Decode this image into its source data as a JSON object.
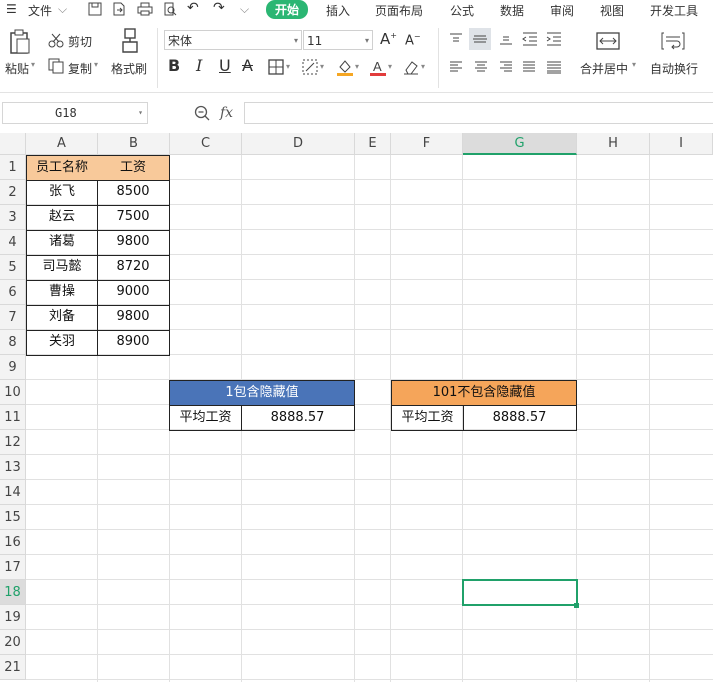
{
  "menu": {
    "hamburger_icon": "menu-icon",
    "file": "文件",
    "tabs": [
      "开始",
      "插入",
      "页面布局",
      "公式",
      "数据",
      "审阅",
      "视图",
      "开发工具"
    ],
    "active_tab": "开始"
  },
  "ribbon": {
    "paste": "粘贴",
    "cut": "剪切",
    "copy": "复制",
    "format_painter": "格式刷",
    "font_name": "宋体",
    "font_size": "11",
    "merge_center": "合并居中",
    "wrap_text": "自动换行",
    "bold": "B",
    "italic": "I",
    "underline": "U",
    "strike": "A"
  },
  "formula_bar": {
    "cell_ref": "G18",
    "fx": "fx",
    "formula": ""
  },
  "columns": [
    "A",
    "B",
    "C",
    "D",
    "E",
    "F",
    "G",
    "H",
    "I"
  ],
  "rows": [
    "1",
    "2",
    "3",
    "4",
    "5",
    "6",
    "7",
    "8",
    "9",
    "10",
    "11",
    "12",
    "13",
    "14",
    "15",
    "16",
    "17",
    "18",
    "19",
    "20",
    "21"
  ],
  "selected_column": "G",
  "selected_row": "18",
  "table": {
    "headers": [
      "员工名称",
      "工资"
    ],
    "rows": [
      [
        "张飞",
        "8500"
      ],
      [
        "赵云",
        "7500"
      ],
      [
        "诸葛",
        "9800"
      ],
      [
        "司马懿",
        "8720"
      ],
      [
        "曹操",
        "9000"
      ],
      [
        "刘备",
        "9800"
      ],
      [
        "关羽",
        "8900"
      ]
    ]
  },
  "block1": {
    "title": "1包含隐藏值",
    "label": "平均工资",
    "value": "8888.57"
  },
  "block2": {
    "title": "101不包含隐藏值",
    "label": "平均工资",
    "value": "8888.57"
  },
  "colors": {
    "accent": "#20a16a",
    "table_header_fill": "#f8c99a",
    "block1_header_fill": "#4a74b8",
    "block2_header_fill": "#f5a55a"
  }
}
